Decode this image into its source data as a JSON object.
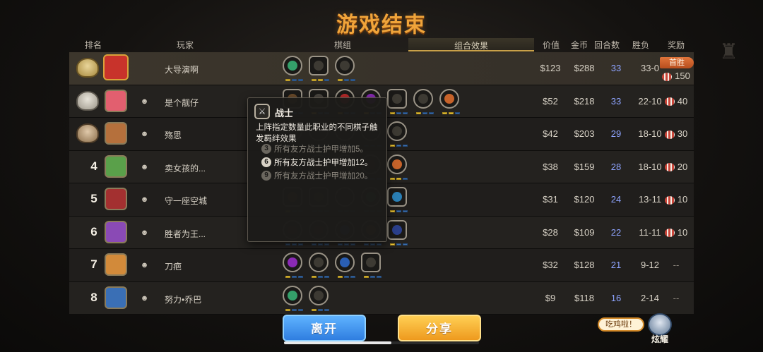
{
  "title": "游戏结束",
  "headers": {
    "rank": "排名",
    "player": "玩家",
    "pieces": "棋组",
    "combo": "组合效果",
    "value": "价值",
    "gold": "金币",
    "rounds": "回合数",
    "winloss": "胜负",
    "reward": "奖励"
  },
  "rows": [
    {
      "rank": "1",
      "name": "大导演啊",
      "value": "$123",
      "gold": "$288",
      "rounds": "33",
      "wl": "33-0",
      "reward": "150",
      "badge": "首胜",
      "avatar_color": "#c8332b",
      "pieces": [
        {
          "c": "#34a06a",
          "shape": "round",
          "pips": [
            1,
            0,
            0
          ]
        },
        {
          "c": "#3d3a33",
          "shape": "hex",
          "pips": [
            1,
            1,
            0
          ]
        },
        {
          "c": "#3d3a33",
          "shape": "round",
          "pips": [
            1,
            0,
            0
          ]
        }
      ]
    },
    {
      "rank": "2",
      "name": "是个靓仔",
      "value": "$52",
      "gold": "$218",
      "rounds": "33",
      "wl": "22-10",
      "reward": "40",
      "avatar_color": "#e25f6f",
      "pieces": [
        {
          "c": "#6a4b2a",
          "shape": "hex",
          "pips": [
            1,
            0,
            0
          ]
        },
        {
          "c": "#4a4640",
          "shape": "hex",
          "pips": [
            1,
            0,
            0
          ]
        },
        {
          "c": "#b72a2a",
          "shape": "round",
          "pips": [
            1,
            0,
            0
          ]
        },
        {
          "c": "#8a2ab5",
          "shape": "round",
          "pips": [
            1,
            0,
            0
          ]
        },
        {
          "c": "#3d3a33",
          "shape": "hex",
          "pips": [
            1,
            0,
            0
          ]
        },
        {
          "c": "#3d3a33",
          "shape": "round",
          "pips": [
            1,
            0,
            0
          ]
        },
        {
          "c": "#c7632a",
          "shape": "round",
          "pips": [
            1,
            1,
            0
          ]
        }
      ]
    },
    {
      "rank": "3",
      "name": "殇思",
      "value": "$42",
      "gold": "$203",
      "rounds": "29",
      "wl": "18-10",
      "reward": "30",
      "avatar_color": "#b5703c",
      "pieces": [
        {
          "c": "#3d3a33",
          "shape": "round",
          "pips": [
            0,
            0,
            0
          ]
        },
        {
          "c": "#3d3a33",
          "shape": "round",
          "pips": [
            0,
            0,
            0
          ]
        },
        {
          "c": "#3d3a33",
          "shape": "round",
          "pips": [
            0,
            0,
            0
          ]
        },
        {
          "c": "#3d3a33",
          "shape": "round",
          "pips": [
            0,
            0,
            0
          ]
        },
        {
          "c": "#3d3a33",
          "shape": "round",
          "pips": [
            1,
            0,
            0
          ]
        }
      ]
    },
    {
      "rank": "4",
      "name": "卖女孩的...",
      "value": "$38",
      "gold": "$159",
      "rounds": "28",
      "wl": "18-10",
      "reward": "20",
      "avatar_color": "#5aa04a",
      "pieces": [
        {
          "c": "#3d3a33",
          "shape": "round",
          "pips": [
            0,
            0,
            0
          ]
        },
        {
          "c": "#3d3a33",
          "shape": "round",
          "pips": [
            0,
            0,
            0
          ]
        },
        {
          "c": "#3d3a33",
          "shape": "round",
          "pips": [
            0,
            0,
            0
          ]
        },
        {
          "c": "#3d3a33",
          "shape": "round",
          "pips": [
            0,
            0,
            0
          ]
        },
        {
          "c": "#c7632a",
          "shape": "round",
          "pips": [
            1,
            1,
            0
          ]
        }
      ]
    },
    {
      "rank": "5",
      "name": "守一座空城",
      "value": "$31",
      "gold": "$120",
      "rounds": "24",
      "wl": "13-11",
      "reward": "10",
      "avatar_color": "#a33030",
      "pieces": [
        {
          "c": "#8a4a20",
          "shape": "hex",
          "pips": [
            1,
            0,
            0
          ]
        },
        {
          "c": "#4a4640",
          "shape": "hex",
          "pips": [
            0,
            0,
            0
          ]
        },
        {
          "c": "#3d3a33",
          "shape": "round",
          "pips": [
            0,
            0,
            0
          ]
        },
        {
          "c": "#34a06a",
          "shape": "round",
          "pips": [
            0,
            0,
            0
          ]
        },
        {
          "c": "#2a7fb5",
          "shape": "hex",
          "pips": [
            1,
            0,
            0
          ]
        }
      ]
    },
    {
      "rank": "6",
      "name": "胜者为王...",
      "value": "$28",
      "gold": "$109",
      "rounds": "22",
      "wl": "11-11",
      "reward": "10",
      "avatar_color": "#8a4ab5",
      "pieces": [
        {
          "c": "#3d3a33",
          "shape": "round",
          "pips": [
            0,
            0,
            0
          ]
        },
        {
          "c": "#3d3a33",
          "shape": "round",
          "pips": [
            0,
            0,
            0
          ]
        },
        {
          "c": "#2a5fb5",
          "shape": "round",
          "pips": [
            0,
            0,
            0
          ]
        },
        {
          "c": "#8a4a20",
          "shape": "round",
          "pips": [
            0,
            0,
            0
          ]
        },
        {
          "c": "#2a3f8a",
          "shape": "hex",
          "pips": [
            1,
            0,
            0
          ]
        }
      ]
    },
    {
      "rank": "7",
      "name": "刀疤",
      "value": "$32",
      "gold": "$128",
      "rounds": "21",
      "wl": "9-12",
      "reward": "--",
      "avatar_color": "#d28a3a",
      "pieces": [
        {
          "c": "#8a2ab5",
          "shape": "round",
          "pips": [
            1,
            0,
            0
          ]
        },
        {
          "c": "#3d3a33",
          "shape": "round",
          "pips": [
            1,
            0,
            0
          ]
        },
        {
          "c": "#2a5fb5",
          "shape": "round",
          "pips": [
            1,
            0,
            0
          ]
        },
        {
          "c": "#3d3a33",
          "shape": "hex",
          "pips": [
            1,
            0,
            0
          ]
        }
      ]
    },
    {
      "rank": "8",
      "name": "努力•乔巴",
      "value": "$9",
      "gold": "$118",
      "rounds": "16",
      "wl": "2-14",
      "reward": "--",
      "avatar_color": "#3a6fb5",
      "pieces": [
        {
          "c": "#34a06a",
          "shape": "round",
          "pips": [
            1,
            0,
            0
          ]
        },
        {
          "c": "#3d3a33",
          "shape": "round",
          "pips": [
            1,
            0,
            0
          ]
        }
      ]
    }
  ],
  "tooltip": {
    "title": "战士",
    "desc": "上阵指定数量此职业的不同棋子触发羁绊效果",
    "tiers": [
      {
        "n": "3",
        "text": "所有友方战士护甲增加5。",
        "active": false
      },
      {
        "n": "6",
        "text": "所有友方战士护甲增加12。",
        "active": true
      },
      {
        "n": "9",
        "text": "所有友方战士护甲增加20。",
        "active": false
      }
    ]
  },
  "buttons": {
    "leave": "离开",
    "share": "分享"
  },
  "chicken_bubble": "吃鸡啦！",
  "show_off": "炫耀",
  "progress": 0.55
}
